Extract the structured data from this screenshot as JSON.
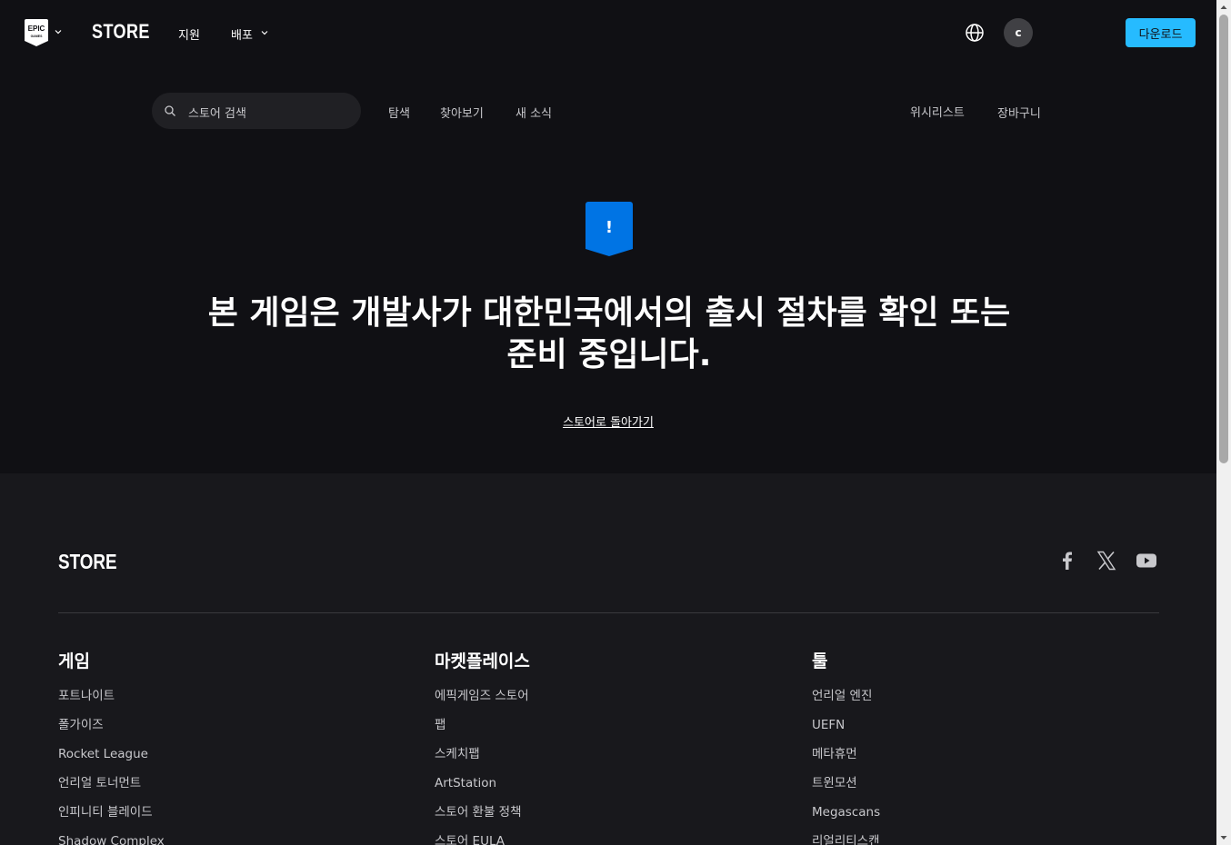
{
  "topnav": {
    "logo_text": "EPIC GAMES",
    "store_label": "STORE",
    "links": [
      "지원",
      "배포"
    ],
    "avatar_initial": "c",
    "download_label": "다운로드"
  },
  "subnav": {
    "search_placeholder": "스토어 검색",
    "links": [
      "탐색",
      "찾아보기",
      "새 소식"
    ],
    "right_links": [
      "위시리스트",
      "장바구니"
    ]
  },
  "main": {
    "badge_symbol": "!",
    "headline": "본 게임은 개발사가 대한민국에서의 출시 절차를 확인 또는 준비 중입니다.",
    "back_link": "스토어로 돌아가기"
  },
  "footer": {
    "store_label": "STORE",
    "social_icons": [
      "facebook-icon",
      "x-icon",
      "youtube-icon"
    ],
    "columns": [
      {
        "title": "게임",
        "items": [
          "포트나이트",
          "폴가이즈",
          "Rocket League",
          "언리얼 토너먼트",
          "인피니티 블레이드",
          "Shadow Complex"
        ]
      },
      {
        "title": "마켓플레이스",
        "items": [
          "에픽게임즈 스토어",
          "팹",
          "스케치팹",
          "ArtStation",
          "스토어 환불 정책",
          "스토어 EULA"
        ]
      },
      {
        "title": "툴",
        "items": [
          "언리얼 엔진",
          "UEFN",
          "메타휴먼",
          "트윈모션",
          "Megascans",
          "리얼리티스캔"
        ]
      }
    ]
  },
  "colors": {
    "background": "#101014",
    "footer_bg": "#18181c",
    "accent": "#26bbff",
    "badge": "#0074e4"
  }
}
